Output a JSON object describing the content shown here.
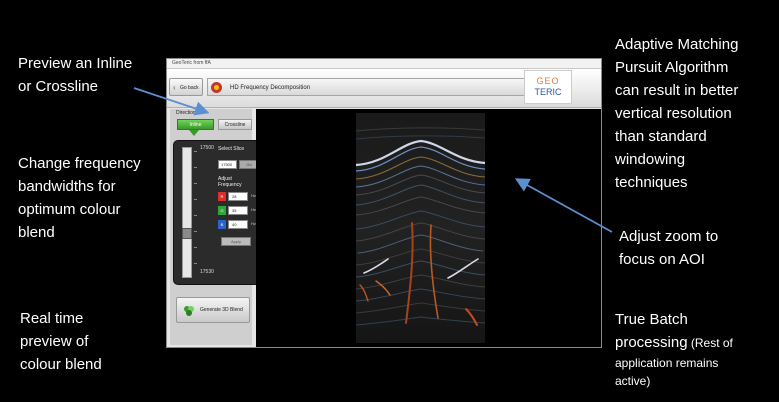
{
  "callouts": {
    "preview": [
      "Preview an Inline",
      "or Crossline"
    ],
    "frequency": [
      "Change frequency",
      "bandwidths for",
      "optimum colour",
      "blend"
    ],
    "realtime": [
      "Real time",
      "preview of",
      "colour blend"
    ],
    "adaptive": [
      "Adaptive Matching",
      "Pursuit Algorithm",
      "can result in better",
      "vertical resolution",
      "than standard",
      "windowing",
      "techniques"
    ],
    "zoom": [
      "Adjust zoom to",
      "focus on AOI"
    ],
    "batch": {
      "line1": "True Batch",
      "line2_main": "processing",
      "line2_small": " (Rest of",
      "line3": "application remains",
      "line4": "active)"
    }
  },
  "window": {
    "title": "GeoTeric from ffA",
    "go_back": "Go back",
    "app_title": "HD Frequency Decomposition",
    "logo_top": "GEO",
    "logo_bottom": "TERIC"
  },
  "direction": {
    "label": "Direction",
    "inline": "Inline",
    "crossline": "Crossline"
  },
  "slice": {
    "top_value": "17500",
    "bottom_value": "17530",
    "select_label": "Select Slice",
    "input_value": "17500",
    "go_label": "Go"
  },
  "frequency": {
    "label": "Adjust Frequency",
    "rows": [
      {
        "channel": "R",
        "value": "28",
        "unit": "Hz",
        "color": "#d9302b"
      },
      {
        "channel": "G",
        "value": "35",
        "unit": "Hz",
        "color": "#2fa53a"
      },
      {
        "channel": "B",
        "value": "40",
        "unit": "Hz",
        "color": "#2a63c9"
      }
    ],
    "apply_label": "Apply"
  },
  "generate": {
    "label": "Generate 3D Blend"
  }
}
